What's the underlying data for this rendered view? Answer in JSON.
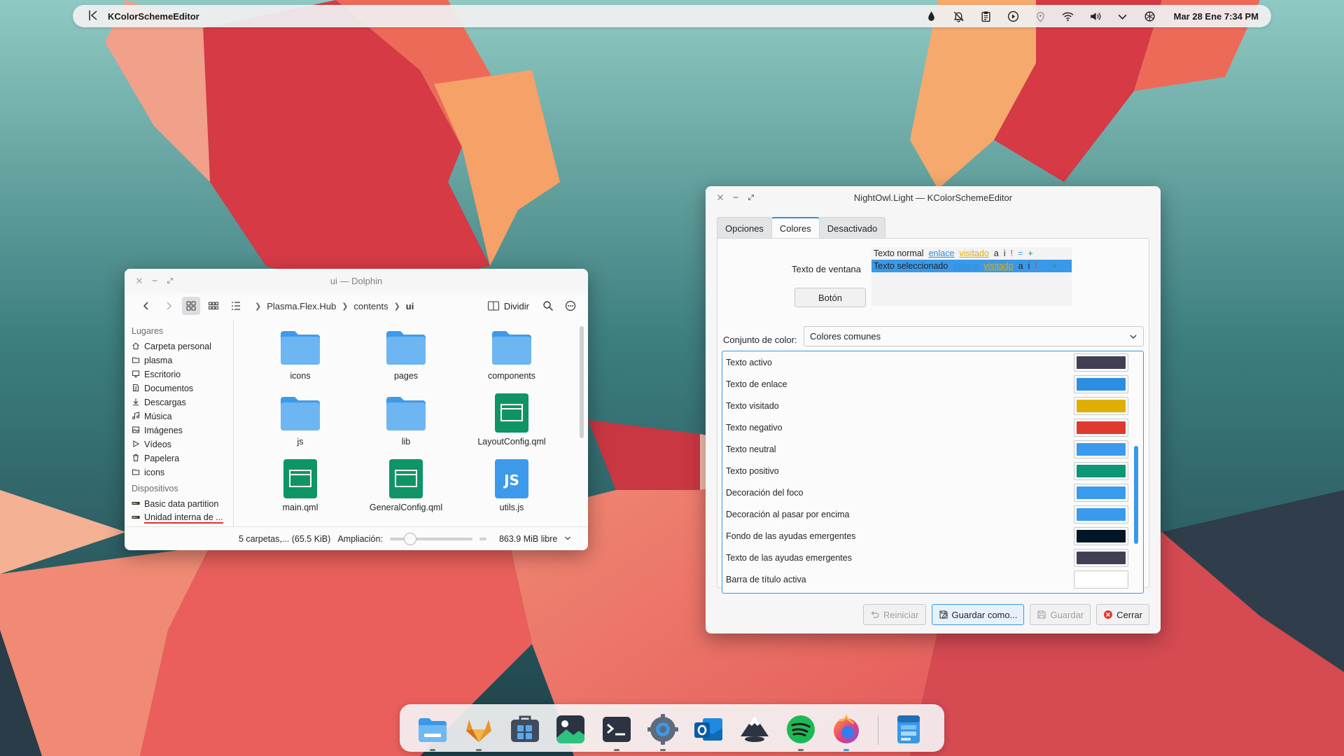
{
  "panel": {
    "app_title": "KColorSchemeEditor",
    "clock": "Mar 28 Ene  7:34 PM"
  },
  "dolphin": {
    "title": "ui — Dolphin",
    "breadcrumb": [
      "Plasma.Flex.Hub",
      "contents",
      "ui"
    ],
    "split_label": "Dividir",
    "places_header": "Lugares",
    "places": [
      {
        "label": "Carpeta personal",
        "icon": "home-icon"
      },
      {
        "label": "plasma",
        "icon": "folder-icon"
      },
      {
        "label": "Escritorio",
        "icon": "desktop-icon"
      },
      {
        "label": "Documentos",
        "icon": "document-icon"
      },
      {
        "label": "Descargas",
        "icon": "download-icon"
      },
      {
        "label": "Música",
        "icon": "music-icon"
      },
      {
        "label": "Imágenes",
        "icon": "image-icon"
      },
      {
        "label": "Vídeos",
        "icon": "video-icon"
      },
      {
        "label": "Papelera",
        "icon": "trash-icon"
      },
      {
        "label": "icons",
        "icon": "folder-icon"
      }
    ],
    "devices_header": "Dispositivos",
    "devices": [
      {
        "label": "Basic data partition",
        "icon": "drive-icon"
      },
      {
        "label": "Unidad interna de ...",
        "icon": "drive-icon"
      }
    ],
    "files": [
      {
        "name": "icons",
        "type": "folder"
      },
      {
        "name": "pages",
        "type": "folder"
      },
      {
        "name": "components",
        "type": "folder"
      },
      {
        "name": "js",
        "type": "folder"
      },
      {
        "name": "lib",
        "type": "folder"
      },
      {
        "name": "LayoutConfig.qml",
        "type": "qml"
      },
      {
        "name": "main.qml",
        "type": "qml"
      },
      {
        "name": "GeneralConfig.qml",
        "type": "qml"
      },
      {
        "name": "utils.js",
        "type": "js"
      }
    ],
    "status": {
      "summary": "5 carpetas,... (65.5 KiB)",
      "zoom_label": "Ampliación:",
      "zoom_level": 0.25,
      "free_space": "863.9 MiB libre"
    }
  },
  "kcse": {
    "title": "NightOwl.Light — KColorSchemeEditor",
    "tabs": [
      "Opciones",
      "Colores",
      "Desactivado"
    ],
    "active_tab": "Colores",
    "preview": {
      "window_text_label": "Texto de ventana",
      "normal_text": "Texto normal",
      "selected_text": "Texto seleccionado",
      "link": "enlace",
      "visited": "visitado",
      "a": "a",
      "i": "i",
      "excl": "!",
      "eq": "=",
      "plus": "+",
      "button_label": "Botón"
    },
    "color_set_label": "Conjunto de color:",
    "color_set_value": "Colores comunes",
    "colors": [
      {
        "label": "Texto activo",
        "color": "#403f53"
      },
      {
        "label": "Texto de enlace",
        "color": "#2b8ee0"
      },
      {
        "label": "Texto visitado",
        "color": "#e0af02"
      },
      {
        "label": "Texto negativo",
        "color": "#e0392f"
      },
      {
        "label": "Texto neutral",
        "color": "#3a9bec"
      },
      {
        "label": "Texto positivo",
        "color": "#0c9876"
      },
      {
        "label": "Decoración del foco",
        "color": "#3a9bec"
      },
      {
        "label": "Decoración al pasar por encima",
        "color": "#3a9bec"
      },
      {
        "label": "Fondo de las ayudas emergentes",
        "color": "#011627"
      },
      {
        "label": "Texto de las ayudas emergentes",
        "color": "#403f53"
      },
      {
        "label": "Barra de título activa",
        "color": "#ffffff"
      }
    ],
    "buttons": {
      "reset": "Reiniciar",
      "save_as": "Guardar como...",
      "save": "Guardar",
      "close": "Cerrar"
    }
  },
  "dock": {
    "apps": [
      "files-icon",
      "gitlab-icon",
      "app-store-icon",
      "image-viewer-icon",
      "terminal-icon",
      "settings-icon",
      "outlook-icon",
      "inkscape-icon",
      "spotify-icon",
      "firefox-icon",
      "kcolorscheme-icon"
    ]
  }
}
